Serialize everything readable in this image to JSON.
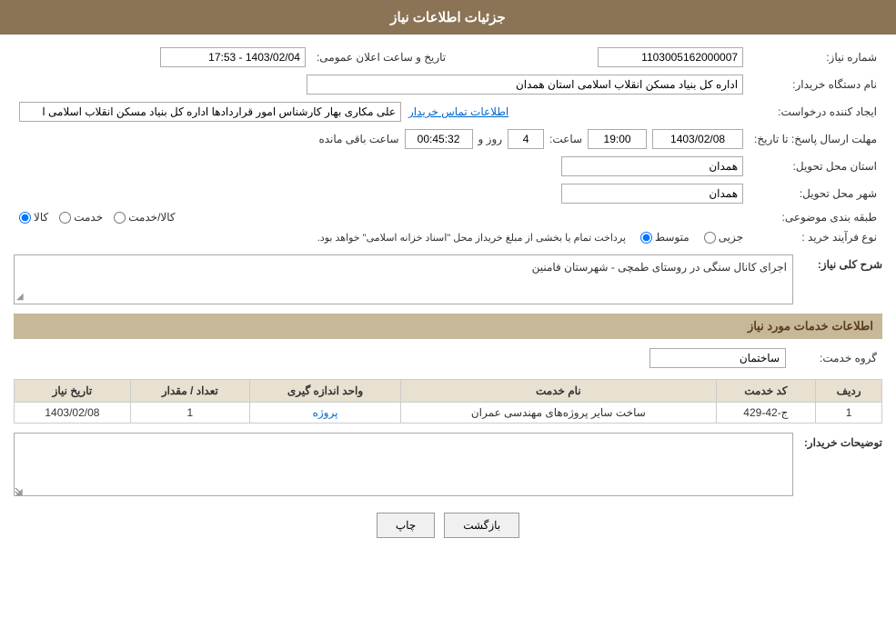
{
  "header": {
    "title": "جزئیات اطلاعات نیاز"
  },
  "fields": {
    "need_number_label": "شماره نیاز:",
    "need_number_value": "1103005162000007",
    "buyer_org_label": "نام دستگاه خریدار:",
    "buyer_org_value": "اداره کل بنیاد مسکن انقلاب اسلامی استان همدان",
    "announcement_datetime_label": "تاریخ و ساعت اعلان عمومی:",
    "announcement_datetime_value": "1403/02/04 - 17:53",
    "creator_label": "ایجاد کننده درخواست:",
    "creator_value": "علی مکاری بهار کارشناس امور قراردادها اداره کل بنیاد مسکن انقلاب اسلامی ا",
    "creator_link": "اطلاعات تماس خریدار",
    "deadline_label": "مهلت ارسال پاسخ: تا تاریخ:",
    "deadline_date": "1403/02/08",
    "deadline_time_label": "ساعت:",
    "deadline_time": "19:00",
    "deadline_days_label": "روز و",
    "deadline_days": "4",
    "deadline_remaining_label": "ساعت باقی مانده",
    "deadline_remaining": "00:45:32",
    "province_label": "استان محل تحویل:",
    "province_value": "همدان",
    "city_label": "شهر محل تحویل:",
    "city_value": "همدان",
    "category_label": "طبقه بندی موضوعی:",
    "category_options": [
      "کالا",
      "خدمت",
      "کالا/خدمت"
    ],
    "category_selected": "کالا",
    "purchase_type_label": "نوع فرآیند خرید :",
    "purchase_type_options": [
      "جزیی",
      "متوسط"
    ],
    "purchase_type_selected": "متوسط",
    "purchase_type_note": "پرداخت تمام یا بخشی از مبلغ خریداز محل \"اسناد خزانه اسلامی\" خواهد بود.",
    "description_label": "شرح کلی نیاز:",
    "description_value": "اجرای کانال سنگی در روستای طمچی - شهرستان فامنین",
    "services_section_label": "اطلاعات خدمات مورد نیاز",
    "service_group_label": "گروه خدمت:",
    "service_group_value": "ساختمان",
    "table": {
      "headers": [
        "ردیف",
        "کد خدمت",
        "نام خدمت",
        "واحد اندازه گیری",
        "تعداد / مقدار",
        "تاریخ نیاز"
      ],
      "rows": [
        {
          "row": "1",
          "code": "ج-42-429",
          "name": "ساخت سایر پروژه‌های مهندسی عمران",
          "unit": "پروژه",
          "quantity": "1",
          "date": "1403/02/08"
        }
      ]
    },
    "buyer_desc_label": "توضیحات خریدار:",
    "buyer_desc_value": ""
  },
  "buttons": {
    "print": "چاپ",
    "back": "بازگشت"
  }
}
